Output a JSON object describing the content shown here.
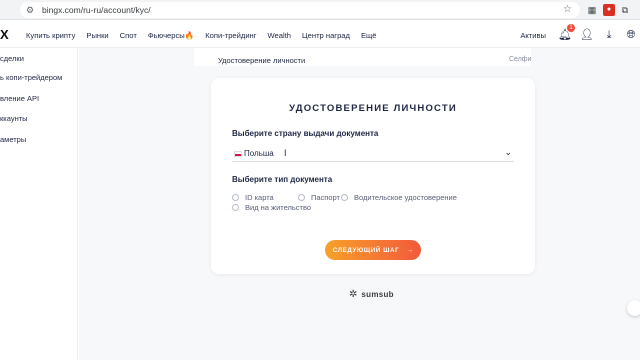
{
  "browser": {
    "url": "bingx.com/ru-ru/account/kyc/"
  },
  "header": {
    "logo": "X",
    "nav": [
      "Купить крипту",
      "Рынки",
      "Спот",
      "Фьючерсы🔥",
      "Копи-трейдинг",
      "Wealth",
      "Центр наград",
      "Ещё"
    ],
    "assets_label": "Активы",
    "notification_count": "1"
  },
  "sidebar": {
    "items": [
      "сделки",
      "ь копи-трейдером",
      "вление API",
      "ккаунты",
      "аметры"
    ]
  },
  "steps": {
    "identity": "Удостоверение личности",
    "selfie": "Селфи"
  },
  "card": {
    "title": "УДОСТОВЕРЕНИЕ ЛИЧНОСТИ",
    "country_label": "Выберите страну выдачи документа",
    "country_value": "Польша",
    "doc_type_label": "Выберите тип документа",
    "doc_types": [
      "ID карта",
      "Паспорт",
      "Водительское удостоверение",
      "Вид на жительство"
    ],
    "next_button": "СЛЕДУЮЩИЙ ШАГ"
  },
  "footer": {
    "provider": "sumsub"
  },
  "colors": {
    "accent_start": "#f7a12a",
    "accent_end": "#f2593b",
    "text_dark": "#1f2744"
  }
}
